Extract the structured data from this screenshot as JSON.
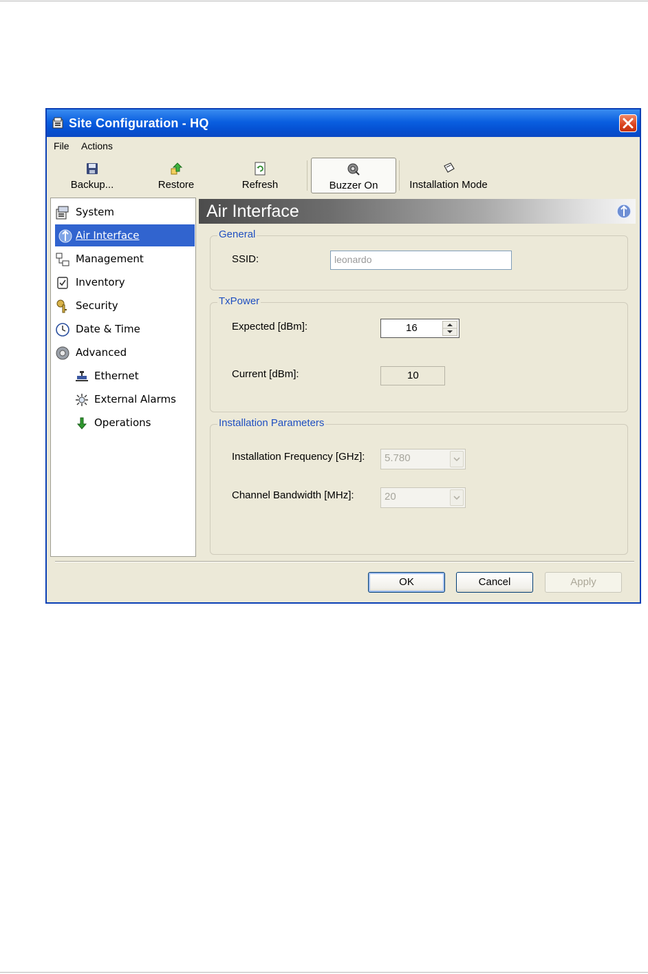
{
  "window": {
    "title": "Site Configuration - HQ",
    "close_label": "✕"
  },
  "menu": [
    {
      "label": "File"
    },
    {
      "label": "Actions"
    }
  ],
  "toolbar": {
    "backup_label": "Backup...",
    "restore_label": "Restore",
    "refresh_label": "Refresh",
    "buzzer_label": "Buzzer On",
    "installation_label": "Installation Mode"
  },
  "nav": {
    "items": [
      {
        "label": "System",
        "icon": "system-icon"
      },
      {
        "label": "Air Interface",
        "icon": "air-interface-icon",
        "selected": true
      },
      {
        "label": "Management",
        "icon": "management-icon"
      },
      {
        "label": "Inventory",
        "icon": "inventory-icon"
      },
      {
        "label": "Security",
        "icon": "security-icon"
      },
      {
        "label": "Date & Time",
        "icon": "clock-icon"
      },
      {
        "label": "Advanced",
        "icon": "advanced-icon"
      },
      {
        "label": "Ethernet",
        "icon": "ethernet-icon"
      },
      {
        "label": "External Alarms",
        "icon": "alarm-icon"
      },
      {
        "label": "Operations",
        "icon": "operations-icon"
      }
    ]
  },
  "panel": {
    "title": "Air Interface",
    "general": {
      "title": "General",
      "ssid_label": "SSID:",
      "ssid_value": "leonardo"
    },
    "txpower": {
      "title": "TxPower",
      "expected_label": "Expected [dBm]:",
      "expected_value": "16",
      "current_label": "Current [dBm]:",
      "current_value": "10"
    },
    "installation": {
      "title": "Installation Parameters",
      "frequency_label": "Installation Frequency [GHz]:",
      "frequency_value": "5.780",
      "bandwidth_label": "Channel Bandwidth [MHz]:",
      "bandwidth_value": "20"
    }
  },
  "buttons": {
    "ok": "OK",
    "cancel": "Cancel",
    "apply": "Apply"
  },
  "colors": {
    "titlebar": "#0a5fe0",
    "selection": "#3164cf",
    "group_title": "#1f4fc0",
    "window_bg": "#ece9d8"
  }
}
